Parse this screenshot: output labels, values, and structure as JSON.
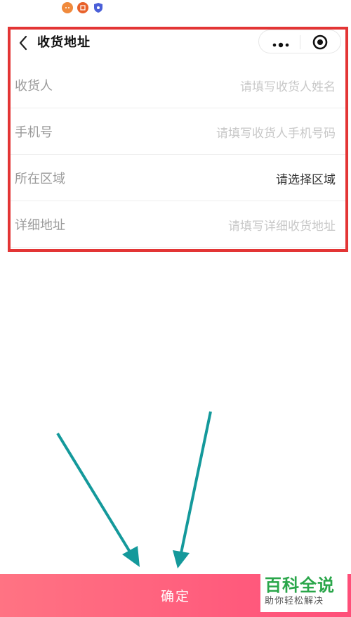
{
  "page": {
    "title": "收货地址"
  },
  "form": {
    "rows": [
      {
        "label": "收货人",
        "placeholder": "请填写收货人姓名"
      },
      {
        "label": "手机号",
        "placeholder": "请填写收货人手机号码"
      },
      {
        "label": "所在区域",
        "value": "请选择区域"
      },
      {
        "label": "详细地址",
        "placeholder": "请填写详细收货地址"
      }
    ]
  },
  "footer": {
    "confirm_label": "确定"
  },
  "watermark": {
    "title": "百科全说",
    "subtitle": "助你轻松解决"
  },
  "colors": {
    "highlight_border": "#e33535",
    "confirm_gradient_start": "#ff7383",
    "confirm_gradient_end": "#ff4f79",
    "arrow": "#14999b",
    "watermark_green": "#2aa64a"
  },
  "icons": [
    "back-arrow-icon",
    "more-dots-icon",
    "close-target-icon"
  ]
}
